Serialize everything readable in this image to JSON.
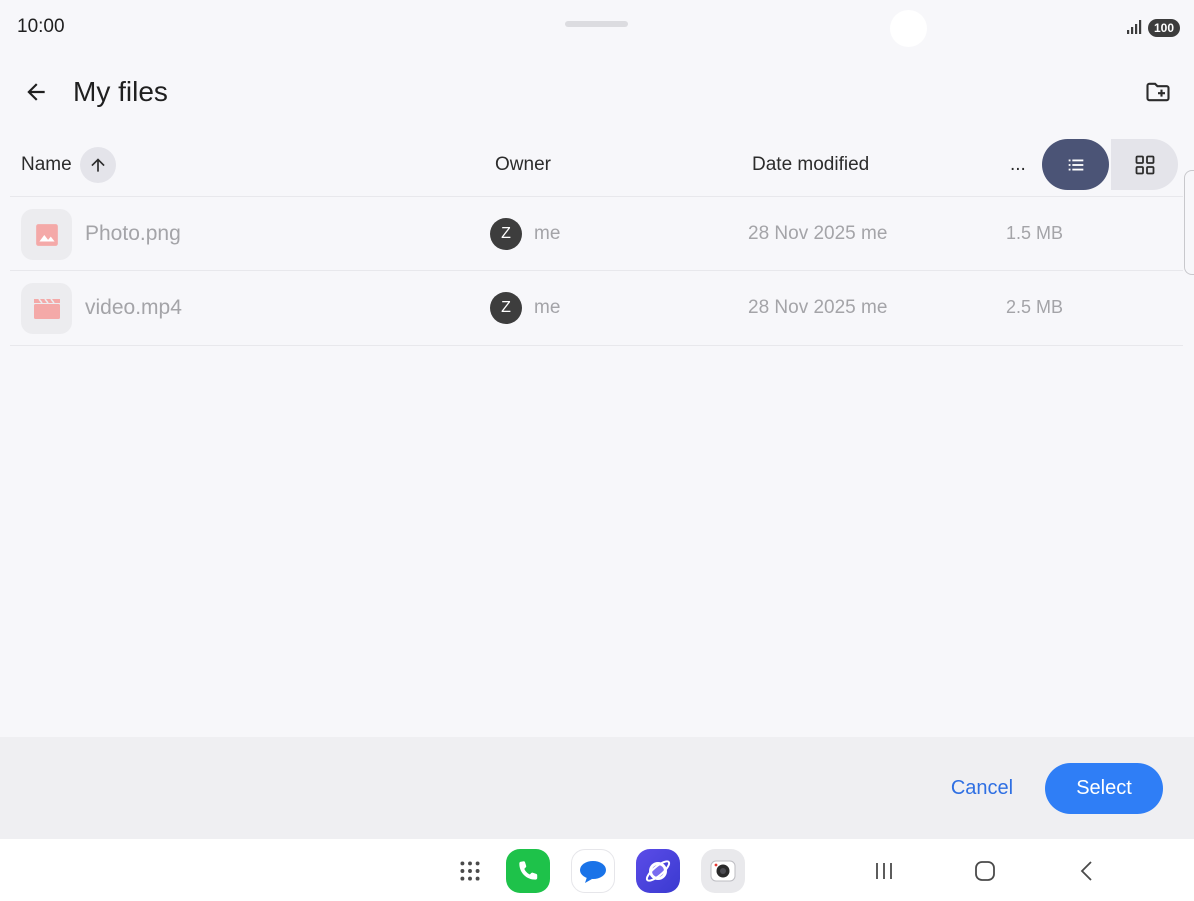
{
  "status_bar": {
    "time": "10:00",
    "battery": "100"
  },
  "header": {
    "title": "My files"
  },
  "columns": {
    "name": "Name",
    "owner": "Owner",
    "date_modified": "Date modified",
    "more": "..."
  },
  "files": [
    {
      "name": "Photo.png",
      "type": "image",
      "owner_initial": "Z",
      "owner": "me",
      "date": "28 Nov 2025 me",
      "size": "1.5 MB"
    },
    {
      "name": "video.mp4",
      "type": "video",
      "owner_initial": "Z",
      "owner": "me",
      "date": "28 Nov 2025 me",
      "size": "2.5 MB"
    }
  ],
  "actions": {
    "cancel_label": "Cancel",
    "select_label": "Select"
  },
  "colors": {
    "accent": "#2f7ef6",
    "view_toggle_active": "#4b5476",
    "file_icon": "#f4a9a8"
  },
  "icons": {
    "back": "arrow-left-icon",
    "new_folder": "create-new-folder-icon",
    "sort": "arrow-up-icon",
    "list_view": "list-view-icon",
    "grid_view": "grid-view-icon",
    "dock": [
      "apps-grid-icon",
      "phone-app-icon",
      "messages-app-icon",
      "internet-app-icon",
      "camera-app-icon"
    ],
    "nav": [
      "recents-icon",
      "home-icon",
      "back-nav-icon"
    ]
  }
}
